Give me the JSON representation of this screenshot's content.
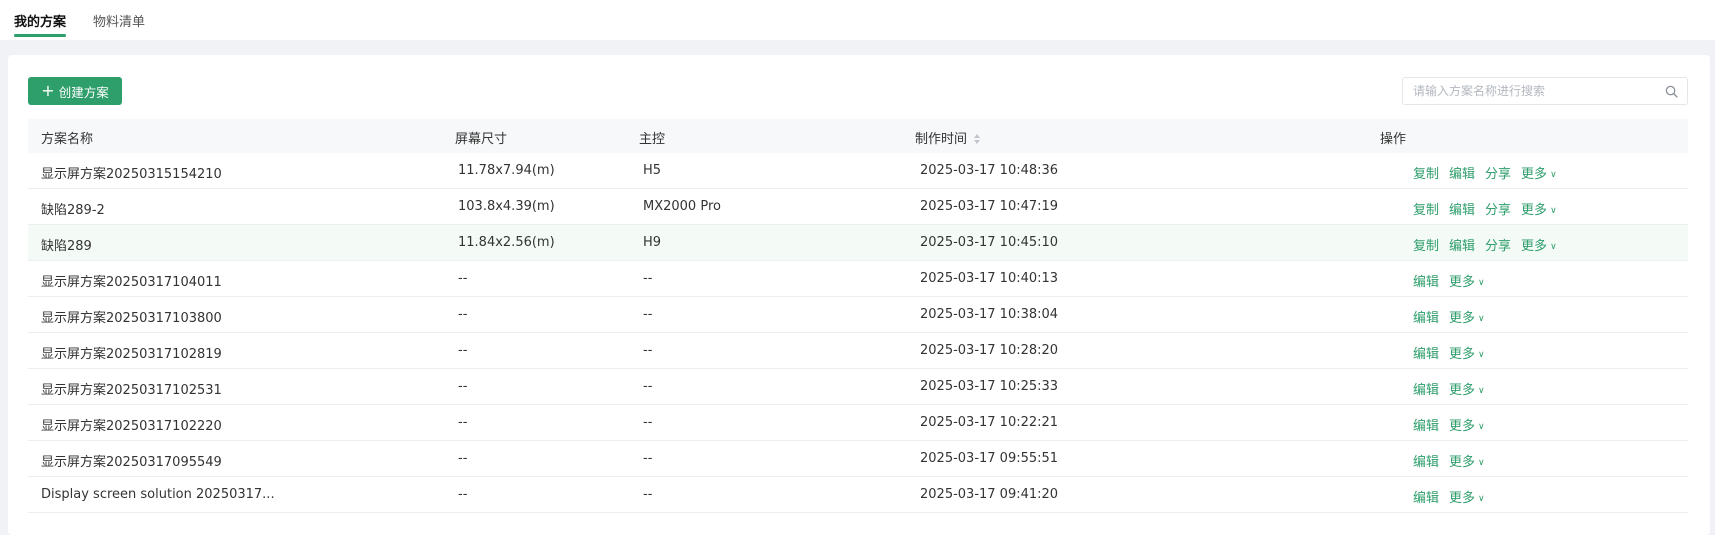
{
  "tabs": [
    {
      "label": "我的方案",
      "active": true
    },
    {
      "label": "物料清单",
      "active": false
    }
  ],
  "toolbar": {
    "create_label": "创建方案",
    "search_placeholder": "请输入方案名称进行搜索"
  },
  "table": {
    "headers": {
      "name": "方案名称",
      "size": "屏幕尺寸",
      "controller": "主控",
      "time": "制作时间",
      "actions": "操作"
    },
    "rows": [
      {
        "name": "显示屏方案20250315154210",
        "size": "11.78x7.94(m)",
        "controller": "H5",
        "time": "2025-03-17 10:48:36",
        "actions": [
          "复制",
          "编辑",
          "分享",
          "更多"
        ]
      },
      {
        "name": "缺陷289-2",
        "size": "103.8x4.39(m)",
        "controller": "MX2000 Pro",
        "time": "2025-03-17 10:47:19",
        "actions": [
          "复制",
          "编辑",
          "分享",
          "更多"
        ]
      },
      {
        "name": "缺陷289",
        "size": "11.84x2.56(m)",
        "controller": "H9",
        "time": "2025-03-17 10:45:10",
        "actions": [
          "复制",
          "编辑",
          "分享",
          "更多"
        ],
        "highlight": true
      },
      {
        "name": "显示屏方案20250317104011",
        "size": "--",
        "controller": "--",
        "time": "2025-03-17 10:40:13",
        "actions": [
          "编辑",
          "更多"
        ]
      },
      {
        "name": "显示屏方案20250317103800",
        "size": "--",
        "controller": "--",
        "time": "2025-03-17 10:38:04",
        "actions": [
          "编辑",
          "更多"
        ]
      },
      {
        "name": "显示屏方案20250317102819",
        "size": "--",
        "controller": "--",
        "time": "2025-03-17 10:28:20",
        "actions": [
          "编辑",
          "更多"
        ]
      },
      {
        "name": "显示屏方案20250317102531",
        "size": "--",
        "controller": "--",
        "time": "2025-03-17 10:25:33",
        "actions": [
          "编辑",
          "更多"
        ]
      },
      {
        "name": "显示屏方案20250317102220",
        "size": "--",
        "controller": "--",
        "time": "2025-03-17 10:22:21",
        "actions": [
          "编辑",
          "更多"
        ]
      },
      {
        "name": "显示屏方案20250317095549",
        "size": "--",
        "controller": "--",
        "time": "2025-03-17 09:55:51",
        "actions": [
          "编辑",
          "更多"
        ]
      },
      {
        "name": "Display screen solution 20250317...",
        "size": "--",
        "controller": "--",
        "time": "2025-03-17 09:41:20",
        "actions": [
          "编辑",
          "更多"
        ]
      }
    ]
  },
  "colors": {
    "accent": "#2e9e6b",
    "highlight_row": "#f4fbf7"
  },
  "icons": {
    "create": "plus-icon",
    "search": "search-icon",
    "sort": "sort-icon",
    "more": "chevron-down-icon"
  }
}
